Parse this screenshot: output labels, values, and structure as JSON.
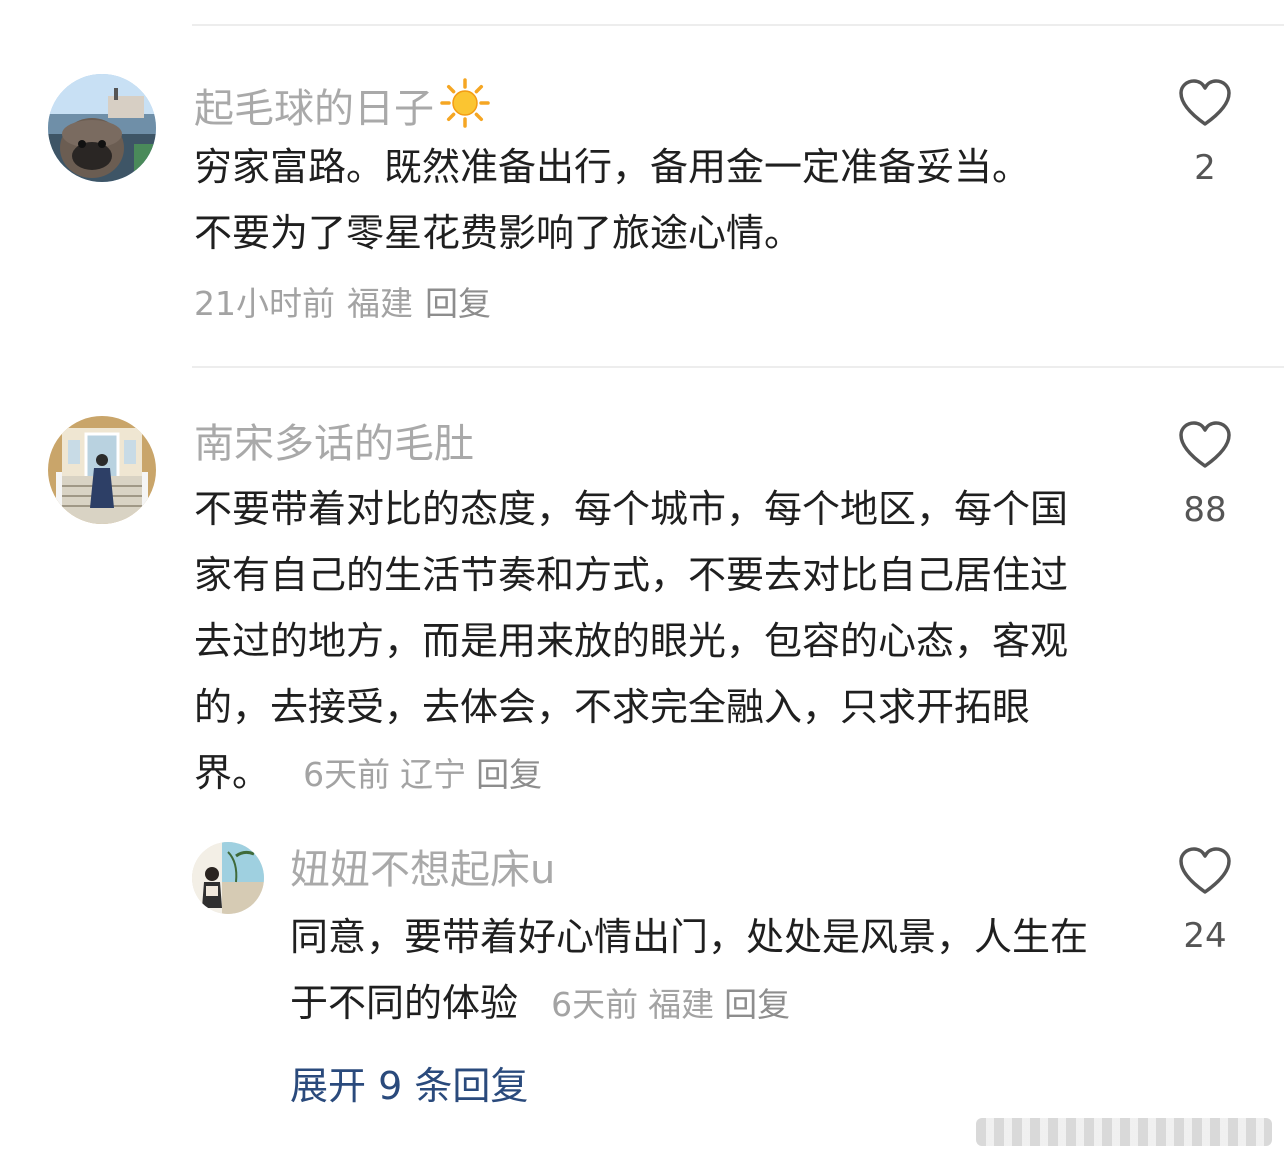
{
  "comments": [
    {
      "username": "起毛球的日子",
      "badge_icon": "sun-icon",
      "text": "穷家富路。既然准备出行，备用金一定准备妥当。不要为了零星花费影响了旅途心情。",
      "time": "21小时前",
      "location": "福建",
      "reply_label": "回复",
      "likes": "2"
    },
    {
      "username": "南宋多话的毛肚",
      "text": "不要带着对比的态度，每个城市，每个地区，每个国家有自己的生活节奏和方式，不要去对比自己居住过去过的地方，而是用来放的眼光，包容的心态，客观的，去接受，去体会，不求完全融入，只求开拓眼界。",
      "time": "6天前",
      "location": "辽宁",
      "reply_label": "回复",
      "likes": "88",
      "replies": [
        {
          "username": "妞妞不想起床u",
          "text": "同意，要带着好心情出门，处处是风景，人生在于不同的体验",
          "time": "6天前",
          "location": "福建",
          "reply_label": "回复",
          "likes": "24"
        }
      ],
      "expand_label": "展开 9 条回复"
    }
  ],
  "colors": {
    "username": "#a9a9a9",
    "text": "#1f1f1f",
    "meta": "#a3a3a3",
    "link": "#2a4a7c",
    "divider": "#ededed"
  }
}
